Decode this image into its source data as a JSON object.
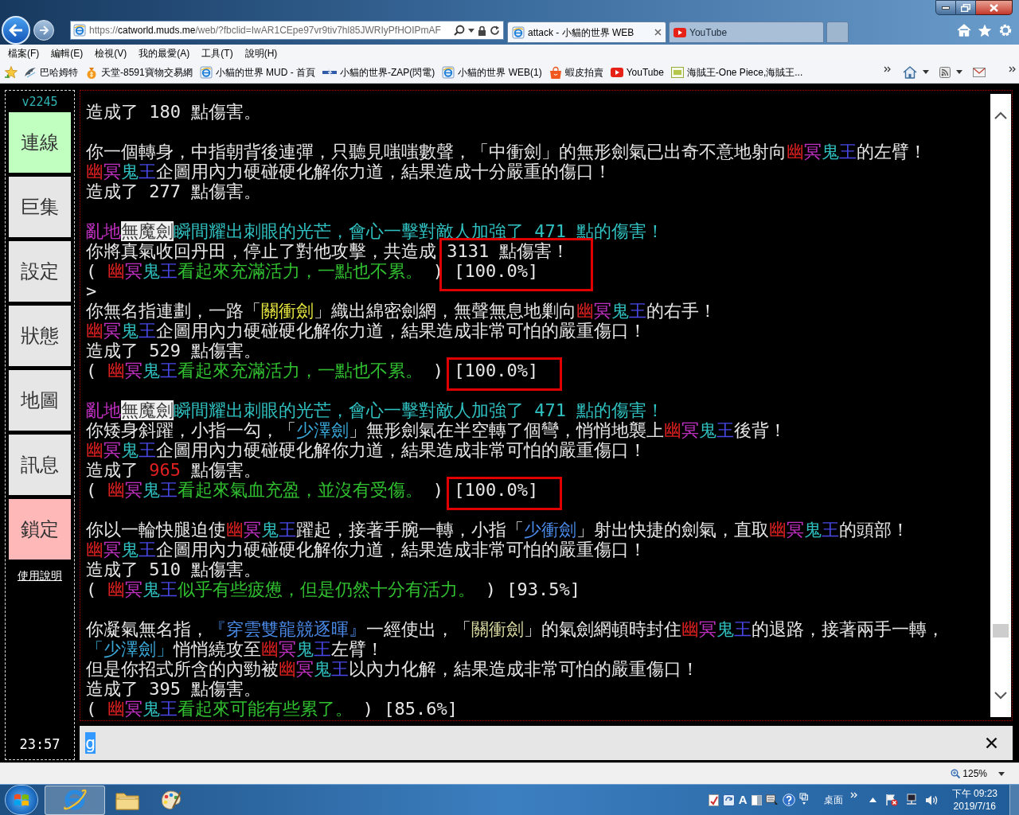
{
  "browser": {
    "address_bar": {
      "scheme": "https://",
      "host": "catworld.muds.me",
      "path": "/web/?fbclid=IwAR1CEpe97vr9tiv7hl85JWRIyPfHOIPmAF"
    },
    "tabs": [
      {
        "label": "attack - 小貓的世界 WEB",
        "kind": "page",
        "selected": true
      },
      {
        "label": "YouTube",
        "kind": "video",
        "selected": false
      }
    ],
    "menu": [
      "檔案(F)",
      "編輯(E)",
      "檢視(V)",
      "我的最愛(A)",
      "工具(T)",
      "說明(H)"
    ],
    "favorites": [
      "巴哈姆特",
      "天堂-8591寶物交易網",
      "小貓的世界 MUD - 首頁",
      "小貓的世界-ZAP(閃電)",
      "小貓的世界 WEB(1)",
      "蝦皮拍賣",
      "YouTube",
      "海賊王-One Piece,海賊王..."
    ]
  },
  "app": {
    "version": "v2245",
    "buttons": [
      {
        "label": "連線",
        "color": "#c0ffc0"
      },
      {
        "label": "巨集",
        "color": "#e6e6e6"
      },
      {
        "label": "設定",
        "color": "#e6e6e6"
      },
      {
        "label": "狀態",
        "color": "#e6e6e6"
      },
      {
        "label": "地圖",
        "color": "#e6e6e6"
      },
      {
        "label": "訊息",
        "color": "#e6e6e6"
      },
      {
        "label": "鎖定",
        "color": "#ffb8b8"
      }
    ],
    "help_link": "使用說明",
    "clock": "23:57",
    "log": [
      {
        "lines": [
          [
            {
              "text": "造成了 180 點傷害。",
              "color": "#e6e6e6"
            }
          ]
        ]
      },
      {
        "lines": [
          [
            {
              "text": "你一個轉身，中指朝背後連彈，只聽見嗤嗤數聲，「中衝劍」的無形劍氣已出奇不意地射向",
              "color": "#e6e6e6"
            },
            {
              "text": "幽",
              "color": "#e02020"
            },
            {
              "text": "冥",
              "color": "#c030c0"
            },
            {
              "text": "鬼",
              "color": "#30c0c0"
            },
            {
              "text": "王",
              "color": "#4848e8"
            },
            {
              "text": "的左臂！",
              "color": "#e6e6e6"
            }
          ],
          [
            {
              "text": "幽",
              "color": "#e02020"
            },
            {
              "text": "冥",
              "color": "#c030c0"
            },
            {
              "text": "鬼",
              "color": "#30c0c0"
            },
            {
              "text": "王",
              "color": "#4848e8"
            },
            {
              "text": "企圖用內力硬碰硬化解你力道，結果造成十分嚴重的傷口！",
              "color": "#e6e6e6"
            }
          ],
          [
            {
              "text": "造成了 277 點傷害。",
              "color": "#e6e6e6"
            }
          ]
        ]
      },
      {
        "lines": [
          [
            {
              "text": "亂地",
              "color": "#c030c0"
            },
            {
              "text": "無魔劍",
              "color": "#3a3a3a",
              "inverse": true
            },
            {
              "text": "瞬間耀出刺眼的光芒，會心一擊對敵人加強了 471 點的傷害！",
              "color": "#30c0c0"
            }
          ],
          [
            {
              "text": "你將真氣收回丹田，停止了對他攻擊，共造成 ",
              "color": "#e6e6e6"
            },
            {
              "text": "3131 點傷害！",
              "color": "#e6e6e6",
              "boxed": true
            }
          ],
          [
            {
              "text": "( ",
              "color": "#e6e6e6"
            },
            {
              "text": "幽",
              "color": "#e02020"
            },
            {
              "text": "冥",
              "color": "#c030c0"
            },
            {
              "text": "鬼",
              "color": "#30c0c0"
            },
            {
              "text": "王",
              "color": "#4848e8"
            },
            {
              "text": "看起來充滿活力，一點也不累。",
              "color": "#30c030"
            },
            {
              "text": " ) ",
              "color": "#e6e6e6"
            },
            {
              "text": "[100.0%]",
              "color": "#e6e6e6",
              "boxed": true
            }
          ],
          [
            {
              "text": ">",
              "color": "#e6e6e6"
            }
          ],
          [
            {
              "text": "你無名指連劃，一路「",
              "color": "#e6e6e6"
            },
            {
              "text": "關衝劍",
              "color": "#e8e840"
            },
            {
              "text": "」織出綿密劍網，無聲無息地剿向",
              "color": "#e6e6e6"
            },
            {
              "text": "幽",
              "color": "#e02020"
            },
            {
              "text": "冥",
              "color": "#c030c0"
            },
            {
              "text": "鬼",
              "color": "#30c0c0"
            },
            {
              "text": "王",
              "color": "#4848e8"
            },
            {
              "text": "的右手！",
              "color": "#e6e6e6"
            }
          ],
          [
            {
              "text": "幽",
              "color": "#e02020"
            },
            {
              "text": "冥",
              "color": "#c030c0"
            },
            {
              "text": "鬼",
              "color": "#30c0c0"
            },
            {
              "text": "王",
              "color": "#4848e8"
            },
            {
              "text": "企圖用內力硬碰硬化解你力道，結果造成非常可怕的嚴重傷口！",
              "color": "#e6e6e6"
            }
          ],
          [
            {
              "text": "造成了 529 點傷害。",
              "color": "#e6e6e6"
            }
          ],
          [
            {
              "text": "( ",
              "color": "#e6e6e6"
            },
            {
              "text": "幽",
              "color": "#e02020"
            },
            {
              "text": "冥",
              "color": "#c030c0"
            },
            {
              "text": "鬼",
              "color": "#30c0c0"
            },
            {
              "text": "王",
              "color": "#4848e8"
            },
            {
              "text": "看起來充滿活力，一點也不累。",
              "color": "#30c030"
            },
            {
              "text": " ) ",
              "color": "#e6e6e6"
            },
            {
              "text": "[100.0%]",
              "color": "#e6e6e6",
              "boxed": true
            }
          ]
        ]
      },
      {
        "lines": [
          [
            {
              "text": "亂地",
              "color": "#c030c0"
            },
            {
              "text": "無魔劍",
              "color": "#3a3a3a",
              "inverse": true
            },
            {
              "text": "瞬間耀出刺眼的光芒，會心一擊對敵人加強了 471 點的傷害！",
              "color": "#30c0c0"
            }
          ],
          [
            {
              "text": "你矮身斜躍，小指一勾，「",
              "color": "#e6e6e6"
            },
            {
              "text": "少澤劍",
              "color": "#3aa8d8"
            },
            {
              "text": "」無形劍氣在半空轉了個彎，悄悄地襲上",
              "color": "#e6e6e6"
            },
            {
              "text": "幽",
              "color": "#e02020"
            },
            {
              "text": "冥",
              "color": "#c030c0"
            },
            {
              "text": "鬼",
              "color": "#30c0c0"
            },
            {
              "text": "王",
              "color": "#4848e8"
            },
            {
              "text": "後背！",
              "color": "#e6e6e6"
            }
          ],
          [
            {
              "text": "幽",
              "color": "#e02020"
            },
            {
              "text": "冥",
              "color": "#c030c0"
            },
            {
              "text": "鬼",
              "color": "#30c0c0"
            },
            {
              "text": "王",
              "color": "#4848e8"
            },
            {
              "text": "企圖用內力硬碰硬化解你力道，結果造成非常可怕的嚴重傷口！",
              "color": "#e6e6e6"
            }
          ],
          [
            {
              "text": "造成了 ",
              "color": "#e6e6e6"
            },
            {
              "text": "965",
              "color": "#e02020"
            },
            {
              "text": " 點傷害。",
              "color": "#e6e6e6"
            }
          ],
          [
            {
              "text": "( ",
              "color": "#e6e6e6"
            },
            {
              "text": "幽",
              "color": "#e02020"
            },
            {
              "text": "冥",
              "color": "#c030c0"
            },
            {
              "text": "鬼",
              "color": "#30c0c0"
            },
            {
              "text": "王",
              "color": "#4848e8"
            },
            {
              "text": "看起來氣血充盈，並沒有受傷。",
              "color": "#30c030"
            },
            {
              "text": " ) ",
              "color": "#e6e6e6"
            },
            {
              "text": "[100.0%]",
              "color": "#e6e6e6",
              "boxed": true
            }
          ]
        ]
      },
      {
        "lines": [
          [
            {
              "text": "你以一輪快腿迫使",
              "color": "#e6e6e6"
            },
            {
              "text": "幽",
              "color": "#e02020"
            },
            {
              "text": "冥",
              "color": "#c030c0"
            },
            {
              "text": "鬼",
              "color": "#30c0c0"
            },
            {
              "text": "王",
              "color": "#4848e8"
            },
            {
              "text": "躍起，接著手腕一轉，小指「",
              "color": "#e6e6e6"
            },
            {
              "text": "少衝劍",
              "color": "#4a8ae8"
            },
            {
              "text": "」射出快捷的劍氣，直取",
              "color": "#e6e6e6"
            },
            {
              "text": "幽",
              "color": "#e02020"
            },
            {
              "text": "冥",
              "color": "#c030c0"
            },
            {
              "text": "鬼",
              "color": "#30c0c0"
            },
            {
              "text": "王",
              "color": "#4848e8"
            },
            {
              "text": "的頭部！",
              "color": "#e6e6e6"
            }
          ],
          [
            {
              "text": "幽",
              "color": "#e02020"
            },
            {
              "text": "冥",
              "color": "#c030c0"
            },
            {
              "text": "鬼",
              "color": "#30c0c0"
            },
            {
              "text": "王",
              "color": "#4848e8"
            },
            {
              "text": "企圖用內力硬碰硬化解你力道，結果造成非常可怕的嚴重傷口！",
              "color": "#e6e6e6"
            }
          ],
          [
            {
              "text": "造成了 510 點傷害。",
              "color": "#e6e6e6"
            }
          ],
          [
            {
              "text": "( ",
              "color": "#e6e6e6"
            },
            {
              "text": "幽",
              "color": "#e02020"
            },
            {
              "text": "冥",
              "color": "#c030c0"
            },
            {
              "text": "鬼",
              "color": "#30c0c0"
            },
            {
              "text": "王",
              "color": "#4848e8"
            },
            {
              "text": "似乎有些疲憊，但是仍然十分有活力。",
              "color": "#30c030"
            },
            {
              "text": " ) [93.5%]",
              "color": "#e6e6e6"
            }
          ]
        ]
      },
      {
        "lines": [
          [
            {
              "text": "你凝氣無名指，",
              "color": "#e6e6e6"
            },
            {
              "text": "『穿雲雙龍競逐暉』",
              "color": "#4a8ae8"
            },
            {
              "text": "一經使出，「",
              "color": "#e6e6e6"
            },
            {
              "text": "關衝劍",
              "color": "#d8d8a0"
            },
            {
              "text": "」的氣劍網頓時封住",
              "color": "#e6e6e6"
            },
            {
              "text": "幽",
              "color": "#e02020"
            },
            {
              "text": "冥",
              "color": "#c030c0"
            },
            {
              "text": "鬼",
              "color": "#30c0c0"
            },
            {
              "text": "王",
              "color": "#4848e8"
            },
            {
              "text": "的退路，接著兩手一轉，",
              "color": "#e6e6e6"
            }
          ],
          [
            {
              "text": "「少澤劍」",
              "color": "#3aa8d8"
            },
            {
              "text": "悄悄繞攻至",
              "color": "#e6e6e6"
            },
            {
              "text": "幽",
              "color": "#e02020"
            },
            {
              "text": "冥",
              "color": "#c030c0"
            },
            {
              "text": "鬼",
              "color": "#30c0c0"
            },
            {
              "text": "王",
              "color": "#4848e8"
            },
            {
              "text": "左臂！",
              "color": "#e6e6e6"
            }
          ],
          [
            {
              "text": "但是你招式所含的內勁被",
              "color": "#e6e6e6"
            },
            {
              "text": "幽",
              "color": "#e02020"
            },
            {
              "text": "冥",
              "color": "#c030c0"
            },
            {
              "text": "鬼",
              "color": "#30c0c0"
            },
            {
              "text": "王",
              "color": "#4848e8"
            },
            {
              "text": "以內力化解，結果造成非常可怕的嚴重傷口！",
              "color": "#e6e6e6"
            }
          ],
          [
            {
              "text": "造成了 395 點傷害。",
              "color": "#e6e6e6"
            }
          ],
          [
            {
              "text": "( ",
              "color": "#e6e6e6"
            },
            {
              "text": "幽",
              "color": "#e02020"
            },
            {
              "text": "冥",
              "color": "#c030c0"
            },
            {
              "text": "鬼",
              "color": "#30c0c0"
            },
            {
              "text": "王",
              "color": "#4848e8"
            },
            {
              "text": "看起來可能有些累了。",
              "color": "#30c030"
            },
            {
              "text": " ) [85.6%]",
              "color": "#e6e6e6"
            }
          ]
        ]
      }
    ],
    "command_input": {
      "value": "g",
      "highlighted": true
    }
  },
  "status_bar": {
    "zoom": "125%"
  },
  "taskbar": {
    "apps": [
      {
        "selected": true
      },
      {
        "selected": false
      },
      {
        "selected": false
      }
    ],
    "ime": "A",
    "desktop": "桌面",
    "time": "下午 09:23",
    "date": "2019/7/16"
  }
}
